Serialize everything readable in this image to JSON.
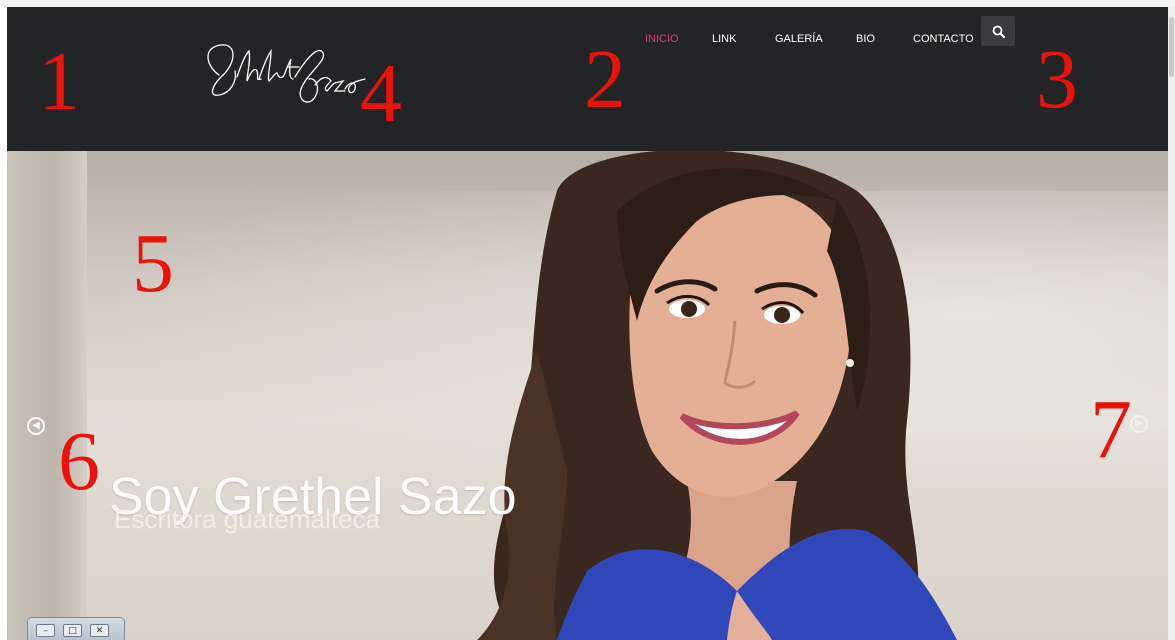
{
  "nav": {
    "items": [
      {
        "label": "INICIO",
        "active": true
      },
      {
        "label": "LINK",
        "active": false
      },
      {
        "label": "GALERÍA",
        "active": false
      },
      {
        "label": "BIO",
        "active": false
      },
      {
        "label": "CONTACTO",
        "active": false
      }
    ],
    "search_icon": "search-icon"
  },
  "logo": {
    "text": "Grethel Sazo",
    "style": "handwritten signature"
  },
  "hero": {
    "title": "Soy Grethel Sazo",
    "subtitle": "Escritora guatemalteca",
    "prev_icon": "arrow-left-circle-icon",
    "next_icon": "arrow-right-circle-icon"
  },
  "annotations": [
    "1",
    "2",
    "3",
    "4",
    "5",
    "6",
    "7"
  ],
  "window_controls": {
    "minimize": "minimize-icon",
    "maximize": "maximize-icon",
    "close": "close-icon"
  },
  "colors": {
    "header_bg": "#232426",
    "nav_active": "#e0397a",
    "nav_text": "#ffffff",
    "annotation_red": "#e8140c"
  }
}
